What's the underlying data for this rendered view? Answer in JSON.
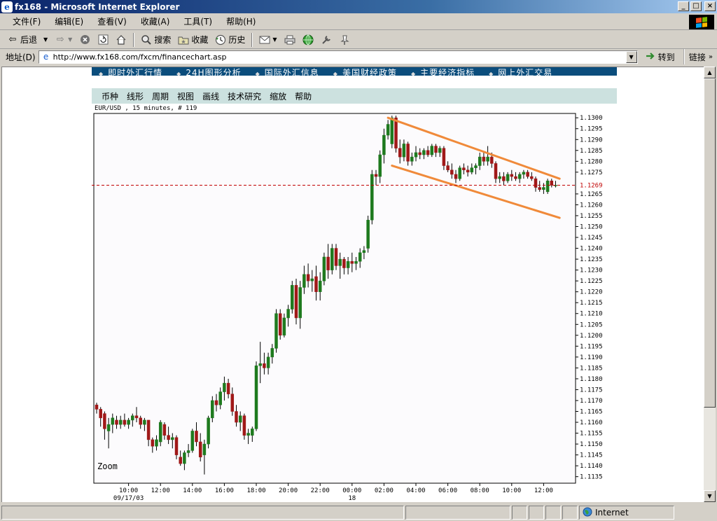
{
  "window": {
    "title": "fx168 - Microsoft Internet Explorer",
    "buttons": [
      "_",
      "□",
      "×"
    ]
  },
  "menubar": {
    "items": [
      "文件(F)",
      "编辑(E)",
      "查看(V)",
      "收藏(A)",
      "工具(T)",
      "帮助(H)"
    ]
  },
  "toolbar": {
    "back_label": "后退",
    "search_label": "搜索",
    "favorites_label": "收藏",
    "history_label": "历史"
  },
  "address": {
    "label": "地址(D)",
    "url": "http://www.fx168.com/fxcm/financechart.asp",
    "go_label": "转到",
    "links_label": "链接"
  },
  "status": {
    "zone": "Internet"
  },
  "site_nav": [
    "即时外汇行情",
    "24H图形分析",
    "国际外汇信息",
    "美国财经政策",
    "主要经济指标",
    "网上外汇交易"
  ],
  "chart_menu": [
    "币种",
    "线形",
    "周期",
    "视图",
    "画线",
    "技术研究",
    "缩放",
    "帮助"
  ],
  "chart_header": "EUR/USD , 15 minutes, # 119",
  "zoom_label": "Zoom",
  "colors": {
    "up": "#1e7a1e",
    "down": "#a01818",
    "channel": "#f08a3a",
    "price_line": "#c00000",
    "chart_bg": "#fcfbfd",
    "menu_bg": "#cce1df",
    "site_nav_bg": "#0b4d7c"
  },
  "chart_data": {
    "type": "candlestick",
    "symbol": "EUR/USD",
    "timeframe": "15 minutes",
    "ylim": [
      1.1132,
      1.1302
    ],
    "ytick_values": [
      1.1135,
      1.114,
      1.1145,
      1.115,
      1.1155,
      1.116,
      1.1165,
      1.117,
      1.1175,
      1.118,
      1.1185,
      1.119,
      1.1195,
      1.12,
      1.1205,
      1.121,
      1.1215,
      1.122,
      1.1225,
      1.123,
      1.1235,
      1.124,
      1.1245,
      1.125,
      1.1255,
      1.126,
      1.1265,
      1.127,
      1.1275,
      1.128,
      1.1285,
      1.129,
      1.1295,
      1.13
    ],
    "ytick_labels": [
      "1.1135",
      "1.1140",
      "1.1145",
      "1.1150",
      "1.1155",
      "1.1160",
      "1.1165",
      "1.1170",
      "1.1175",
      "1.1180",
      "1.1185",
      "1.1190",
      "1.1195",
      "1.1200",
      "1.1205",
      "1.1210",
      "1.1215",
      "1.1220",
      "1.1225",
      "1.1230",
      "1.1235",
      "1.1240",
      "1.1245",
      "1.1250",
      "1.1255",
      "1.1260",
      "1.1265",
      "1.1270",
      "1.1275",
      "1.1280",
      "1.1285",
      "1.1290",
      "1.1295",
      "1.1300"
    ],
    "xticks": [
      {
        "label": "10:00",
        "sub": "09/17/03",
        "t": "2003-09-17 10:00"
      },
      {
        "label": "12:00",
        "sub": "",
        "t": "2003-09-17 12:00"
      },
      {
        "label": "14:00",
        "sub": "",
        "t": "2003-09-17 14:00"
      },
      {
        "label": "16:00",
        "sub": "",
        "t": "2003-09-17 16:00"
      },
      {
        "label": "18:00",
        "sub": "",
        "t": "2003-09-17 18:00"
      },
      {
        "label": "20:00",
        "sub": "",
        "t": "2003-09-17 20:00"
      },
      {
        "label": "22:00",
        "sub": "",
        "t": "2003-09-17 22:00"
      },
      {
        "label": "00:00",
        "sub": "18",
        "t": "2003-09-18 00:00"
      },
      {
        "label": "02:00",
        "sub": "",
        "t": "2003-09-18 02:00"
      },
      {
        "label": "04:00",
        "sub": "",
        "t": "2003-09-18 04:00"
      },
      {
        "label": "06:00",
        "sub": "",
        "t": "2003-09-18 06:00"
      },
      {
        "label": "08:00",
        "sub": "",
        "t": "2003-09-18 08:00"
      },
      {
        "label": "10:00",
        "sub": "",
        "t": "2003-09-18 10:00"
      },
      {
        "label": "12:00",
        "sub": "",
        "t": "2003-09-18 12:00"
      }
    ],
    "current_price": 1.1269,
    "current_price_label": "1.1269",
    "channel_lines": [
      {
        "from": {
          "t": "2003-09-18 02:15",
          "y": 1.13
        },
        "to": {
          "t": "2003-09-18 13:00",
          "y": 1.1272
        }
      },
      {
        "from": {
          "t": "2003-09-18 02:30",
          "y": 1.1278
        },
        "to": {
          "t": "2003-09-18 13:00",
          "y": 1.1254
        }
      }
    ],
    "candles": [
      {
        "t": "2003-09-17 08:00",
        "o": 1.1168,
        "h": 1.1169,
        "l": 1.1164,
        "c": 1.1166
      },
      {
        "t": "2003-09-17 08:15",
        "o": 1.1166,
        "h": 1.1167,
        "l": 1.1158,
        "c": 1.1162
      },
      {
        "t": "2003-09-17 08:30",
        "o": 1.1164,
        "h": 1.1165,
        "l": 1.1152,
        "c": 1.1157
      },
      {
        "t": "2003-09-17 08:45",
        "o": 1.1156,
        "h": 1.1162,
        "l": 1.1148,
        "c": 1.1159
      },
      {
        "t": "2003-09-17 09:00",
        "o": 1.1159,
        "h": 1.1164,
        "l": 1.1155,
        "c": 1.1162
      },
      {
        "t": "2003-09-17 09:15",
        "o": 1.1161,
        "h": 1.1163,
        "l": 1.1157,
        "c": 1.1159
      },
      {
        "t": "2003-09-17 09:30",
        "o": 1.1159,
        "h": 1.1163,
        "l": 1.1157,
        "c": 1.1161
      },
      {
        "t": "2003-09-17 09:45",
        "o": 1.1161,
        "h": 1.1164,
        "l": 1.1158,
        "c": 1.1159
      },
      {
        "t": "2003-09-17 10:00",
        "o": 1.1159,
        "h": 1.1162,
        "l": 1.1157,
        "c": 1.1161
      },
      {
        "t": "2003-09-17 10:15",
        "o": 1.1161,
        "h": 1.1164,
        "l": 1.1158,
        "c": 1.1163
      },
      {
        "t": "2003-09-17 10:30",
        "o": 1.1163,
        "h": 1.1167,
        "l": 1.116,
        "c": 1.1162
      },
      {
        "t": "2003-09-17 10:45",
        "o": 1.1162,
        "h": 1.1163,
        "l": 1.1157,
        "c": 1.1159
      },
      {
        "t": "2003-09-17 11:00",
        "o": 1.1159,
        "h": 1.1162,
        "l": 1.1156,
        "c": 1.1161
      },
      {
        "t": "2003-09-17 11:15",
        "o": 1.1161,
        "h": 1.1161,
        "l": 1.1149,
        "c": 1.1152
      },
      {
        "t": "2003-09-17 11:30",
        "o": 1.1152,
        "h": 1.1153,
        "l": 1.1146,
        "c": 1.1149
      },
      {
        "t": "2003-09-17 11:45",
        "o": 1.1149,
        "h": 1.1154,
        "l": 1.1147,
        "c": 1.1152
      },
      {
        "t": "2003-09-17 12:00",
        "o": 1.1151,
        "h": 1.1161,
        "l": 1.1149,
        "c": 1.116
      },
      {
        "t": "2003-09-17 12:15",
        "o": 1.1159,
        "h": 1.116,
        "l": 1.1152,
        "c": 1.1154
      },
      {
        "t": "2003-09-17 12:30",
        "o": 1.1154,
        "h": 1.1158,
        "l": 1.115,
        "c": 1.1152
      },
      {
        "t": "2003-09-17 12:45",
        "o": 1.1152,
        "h": 1.1155,
        "l": 1.1148,
        "c": 1.1153
      },
      {
        "t": "2003-09-17 13:00",
        "o": 1.1153,
        "h": 1.1154,
        "l": 1.1143,
        "c": 1.1145
      },
      {
        "t": "2003-09-17 13:15",
        "o": 1.1144,
        "h": 1.1147,
        "l": 1.114,
        "c": 1.1141
      },
      {
        "t": "2003-09-17 13:30",
        "o": 1.1141,
        "h": 1.1147,
        "l": 1.1138,
        "c": 1.1146
      },
      {
        "t": "2003-09-17 13:45",
        "o": 1.1146,
        "h": 1.115,
        "l": 1.1144,
        "c": 1.1147
      },
      {
        "t": "2003-09-17 14:00",
        "o": 1.1147,
        "h": 1.1157,
        "l": 1.1146,
        "c": 1.1156
      },
      {
        "t": "2003-09-17 14:15",
        "o": 1.1156,
        "h": 1.116,
        "l": 1.1149,
        "c": 1.1151
      },
      {
        "t": "2003-09-17 14:30",
        "o": 1.1151,
        "h": 1.1155,
        "l": 1.1142,
        "c": 1.1144
      },
      {
        "t": "2003-09-17 14:45",
        "o": 1.1145,
        "h": 1.1152,
        "l": 1.1136,
        "c": 1.115
      },
      {
        "t": "2003-09-17 15:00",
        "o": 1.115,
        "h": 1.1163,
        "l": 1.1148,
        "c": 1.1162
      },
      {
        "t": "2003-09-17 15:15",
        "o": 1.1162,
        "h": 1.1172,
        "l": 1.116,
        "c": 1.117
      },
      {
        "t": "2003-09-17 15:30",
        "o": 1.117,
        "h": 1.1173,
        "l": 1.1165,
        "c": 1.1168
      },
      {
        "t": "2003-09-17 15:45",
        "o": 1.1168,
        "h": 1.1176,
        "l": 1.1166,
        "c": 1.1174
      },
      {
        "t": "2003-09-17 16:00",
        "o": 1.1174,
        "h": 1.1181,
        "l": 1.117,
        "c": 1.1178
      },
      {
        "t": "2003-09-17 16:15",
        "o": 1.1178,
        "h": 1.118,
        "l": 1.1171,
        "c": 1.1173
      },
      {
        "t": "2003-09-17 16:30",
        "o": 1.1173,
        "h": 1.1176,
        "l": 1.1163,
        "c": 1.1165
      },
      {
        "t": "2003-09-17 16:45",
        "o": 1.1165,
        "h": 1.1168,
        "l": 1.1158,
        "c": 1.116
      },
      {
        "t": "2003-09-17 17:00",
        "o": 1.116,
        "h": 1.1165,
        "l": 1.1156,
        "c": 1.1163
      },
      {
        "t": "2003-09-17 17:15",
        "o": 1.1163,
        "h": 1.1164,
        "l": 1.1152,
        "c": 1.1154
      },
      {
        "t": "2003-09-17 17:30",
        "o": 1.1154,
        "h": 1.1157,
        "l": 1.115,
        "c": 1.1155
      },
      {
        "t": "2003-09-17 17:45",
        "o": 1.1154,
        "h": 1.1158,
        "l": 1.1151,
        "c": 1.1157
      },
      {
        "t": "2003-09-17 18:00",
        "o": 1.1157,
        "h": 1.1188,
        "l": 1.1156,
        "c": 1.1186
      },
      {
        "t": "2003-09-17 18:15",
        "o": 1.1186,
        "h": 1.1197,
        "l": 1.1178,
        "c": 1.1187
      },
      {
        "t": "2003-09-17 18:30",
        "o": 1.1187,
        "h": 1.1192,
        "l": 1.1182,
        "c": 1.1185
      },
      {
        "t": "2003-09-17 18:45",
        "o": 1.1185,
        "h": 1.1192,
        "l": 1.1182,
        "c": 1.119
      },
      {
        "t": "2003-09-17 19:00",
        "o": 1.119,
        "h": 1.1196,
        "l": 1.1187,
        "c": 1.1194
      },
      {
        "t": "2003-09-17 19:15",
        "o": 1.1194,
        "h": 1.1212,
        "l": 1.1192,
        "c": 1.121
      },
      {
        "t": "2003-09-17 19:30",
        "o": 1.121,
        "h": 1.1212,
        "l": 1.1198,
        "c": 1.12
      },
      {
        "t": "2003-09-17 19:45",
        "o": 1.12,
        "h": 1.121,
        "l": 1.1199,
        "c": 1.1208
      },
      {
        "t": "2003-09-17 20:00",
        "o": 1.1208,
        "h": 1.1214,
        "l": 1.1204,
        "c": 1.1212
      },
      {
        "t": "2003-09-17 20:15",
        "o": 1.1212,
        "h": 1.1225,
        "l": 1.121,
        "c": 1.1223
      },
      {
        "t": "2003-09-17 20:30",
        "o": 1.1223,
        "h": 1.1226,
        "l": 1.1205,
        "c": 1.1208
      },
      {
        "t": "2003-09-17 20:45",
        "o": 1.1208,
        "h": 1.1225,
        "l": 1.1203,
        "c": 1.1222
      },
      {
        "t": "2003-09-17 21:00",
        "o": 1.1222,
        "h": 1.1232,
        "l": 1.1219,
        "c": 1.1228
      },
      {
        "t": "2003-09-17 21:15",
        "o": 1.1228,
        "h": 1.1233,
        "l": 1.1222,
        "c": 1.1225
      },
      {
        "t": "2003-09-17 21:30",
        "o": 1.1225,
        "h": 1.123,
        "l": 1.122,
        "c": 1.1226
      },
      {
        "t": "2003-09-17 21:45",
        "o": 1.1227,
        "h": 1.1232,
        "l": 1.1216,
        "c": 1.122
      },
      {
        "t": "2003-09-17 22:00",
        "o": 1.122,
        "h": 1.1229,
        "l": 1.1216,
        "c": 1.1225
      },
      {
        "t": "2003-09-17 22:15",
        "o": 1.1225,
        "h": 1.1238,
        "l": 1.1223,
        "c": 1.1236
      },
      {
        "t": "2003-09-17 22:30",
        "o": 1.1236,
        "h": 1.1242,
        "l": 1.1226,
        "c": 1.123
      },
      {
        "t": "2003-09-17 22:45",
        "o": 1.123,
        "h": 1.1242,
        "l": 1.1228,
        "c": 1.124
      },
      {
        "t": "2003-09-17 23:00",
        "o": 1.124,
        "h": 1.1242,
        "l": 1.123,
        "c": 1.1232
      },
      {
        "t": "2003-09-17 23:15",
        "o": 1.1232,
        "h": 1.1238,
        "l": 1.1226,
        "c": 1.1235
      },
      {
        "t": "2003-09-17 23:30",
        "o": 1.1235,
        "h": 1.1236,
        "l": 1.1228,
        "c": 1.1231
      },
      {
        "t": "2003-09-17 23:45",
        "o": 1.1231,
        "h": 1.1236,
        "l": 1.1228,
        "c": 1.1234
      },
      {
        "t": "2003-09-18 00:00",
        "o": 1.1234,
        "h": 1.1238,
        "l": 1.1229,
        "c": 1.1233
      },
      {
        "t": "2003-09-18 00:15",
        "o": 1.1233,
        "h": 1.1236,
        "l": 1.123,
        "c": 1.1234
      },
      {
        "t": "2003-09-18 00:30",
        "o": 1.1234,
        "h": 1.124,
        "l": 1.1231,
        "c": 1.1238
      },
      {
        "t": "2003-09-18 00:45",
        "o": 1.1238,
        "h": 1.1241,
        "l": 1.1235,
        "c": 1.1239
      },
      {
        "t": "2003-09-18 01:00",
        "o": 1.124,
        "h": 1.1255,
        "l": 1.1238,
        "c": 1.1253
      },
      {
        "t": "2003-09-18 01:15",
        "o": 1.1253,
        "h": 1.1276,
        "l": 1.1251,
        "c": 1.1274
      },
      {
        "t": "2003-09-18 01:30",
        "o": 1.1274,
        "h": 1.1276,
        "l": 1.1269,
        "c": 1.1273
      },
      {
        "t": "2003-09-18 01:45",
        "o": 1.1273,
        "h": 1.1285,
        "l": 1.127,
        "c": 1.1283
      },
      {
        "t": "2003-09-18 02:00",
        "o": 1.1283,
        "h": 1.1295,
        "l": 1.1279,
        "c": 1.1292
      },
      {
        "t": "2003-09-18 02:15",
        "o": 1.1292,
        "h": 1.1299,
        "l": 1.129,
        "c": 1.1297
      },
      {
        "t": "2003-09-18 02:30",
        "o": 1.1288,
        "h": 1.1301,
        "l": 1.1286,
        "c": 1.13
      },
      {
        "t": "2003-09-18 02:45",
        "o": 1.13,
        "h": 1.1301,
        "l": 1.1284,
        "c": 1.1286
      },
      {
        "t": "2003-09-18 03:00",
        "o": 1.1286,
        "h": 1.129,
        "l": 1.1279,
        "c": 1.1282
      },
      {
        "t": "2003-09-18 03:15",
        "o": 1.1282,
        "h": 1.129,
        "l": 1.128,
        "c": 1.1288
      },
      {
        "t": "2003-09-18 03:30",
        "o": 1.1288,
        "h": 1.1289,
        "l": 1.1278,
        "c": 1.128
      },
      {
        "t": "2003-09-18 03:45",
        "o": 1.128,
        "h": 1.1284,
        "l": 1.1278,
        "c": 1.1282
      },
      {
        "t": "2003-09-18 04:00",
        "o": 1.1282,
        "h": 1.1287,
        "l": 1.128,
        "c": 1.1284
      },
      {
        "t": "2003-09-18 04:15",
        "o": 1.1284,
        "h": 1.1286,
        "l": 1.1281,
        "c": 1.1283
      },
      {
        "t": "2003-09-18 04:30",
        "o": 1.1283,
        "h": 1.1286,
        "l": 1.1281,
        "c": 1.1285
      },
      {
        "t": "2003-09-18 04:45",
        "o": 1.1285,
        "h": 1.1287,
        "l": 1.1282,
        "c": 1.1283
      },
      {
        "t": "2003-09-18 05:00",
        "o": 1.1283,
        "h": 1.1288,
        "l": 1.1282,
        "c": 1.1287
      },
      {
        "t": "2003-09-18 05:15",
        "o": 1.1287,
        "h": 1.1288,
        "l": 1.1282,
        "c": 1.1284
      },
      {
        "t": "2003-09-18 05:30",
        "o": 1.1284,
        "h": 1.1287,
        "l": 1.1282,
        "c": 1.1286
      },
      {
        "t": "2003-09-18 05:45",
        "o": 1.1286,
        "h": 1.1287,
        "l": 1.1276,
        "c": 1.1278
      },
      {
        "t": "2003-09-18 06:00",
        "o": 1.1278,
        "h": 1.128,
        "l": 1.1275,
        "c": 1.1276
      },
      {
        "t": "2003-09-18 06:15",
        "o": 1.1276,
        "h": 1.1279,
        "l": 1.1272,
        "c": 1.1274
      },
      {
        "t": "2003-09-18 06:30",
        "o": 1.1274,
        "h": 1.1276,
        "l": 1.127,
        "c": 1.1272
      },
      {
        "t": "2003-09-18 06:45",
        "o": 1.1272,
        "h": 1.1278,
        "l": 1.1271,
        "c": 1.1277
      },
      {
        "t": "2003-09-18 07:00",
        "o": 1.1277,
        "h": 1.1279,
        "l": 1.1274,
        "c": 1.1276
      },
      {
        "t": "2003-09-18 07:15",
        "o": 1.1276,
        "h": 1.1278,
        "l": 1.1273,
        "c": 1.1275
      },
      {
        "t": "2003-09-18 07:30",
        "o": 1.1275,
        "h": 1.1279,
        "l": 1.1274,
        "c": 1.1277
      },
      {
        "t": "2003-09-18 07:45",
        "o": 1.1277,
        "h": 1.1279,
        "l": 1.1274,
        "c": 1.1278
      },
      {
        "t": "2003-09-18 08:00",
        "o": 1.1278,
        "h": 1.1284,
        "l": 1.1276,
        "c": 1.1282
      },
      {
        "t": "2003-09-18 08:15",
        "o": 1.1282,
        "h": 1.1284,
        "l": 1.1278,
        "c": 1.128
      },
      {
        "t": "2003-09-18 08:30",
        "o": 1.128,
        "h": 1.1287,
        "l": 1.1278,
        "c": 1.1282
      },
      {
        "t": "2003-09-18 08:45",
        "o": 1.1282,
        "h": 1.1284,
        "l": 1.1277,
        "c": 1.1279
      },
      {
        "t": "2003-09-18 09:00",
        "o": 1.1279,
        "h": 1.128,
        "l": 1.127,
        "c": 1.1272
      },
      {
        "t": "2003-09-18 09:15",
        "o": 1.1272,
        "h": 1.1275,
        "l": 1.127,
        "c": 1.1273
      },
      {
        "t": "2003-09-18 09:30",
        "o": 1.1273,
        "h": 1.1275,
        "l": 1.1269,
        "c": 1.1271
      },
      {
        "t": "2003-09-18 09:45",
        "o": 1.1271,
        "h": 1.1275,
        "l": 1.127,
        "c": 1.1274
      },
      {
        "t": "2003-09-18 10:00",
        "o": 1.1274,
        "h": 1.1276,
        "l": 1.1271,
        "c": 1.1273
      },
      {
        "t": "2003-09-18 10:15",
        "o": 1.1273,
        "h": 1.1275,
        "l": 1.1271,
        "c": 1.1272
      },
      {
        "t": "2003-09-18 10:30",
        "o": 1.1272,
        "h": 1.1275,
        "l": 1.127,
        "c": 1.1274
      },
      {
        "t": "2003-09-18 10:45",
        "o": 1.1274,
        "h": 1.1276,
        "l": 1.1272,
        "c": 1.1275
      },
      {
        "t": "2003-09-18 11:00",
        "o": 1.1275,
        "h": 1.1276,
        "l": 1.1272,
        "c": 1.1273
      },
      {
        "t": "2003-09-18 11:15",
        "o": 1.1273,
        "h": 1.1275,
        "l": 1.1271,
        "c": 1.1272
      },
      {
        "t": "2003-09-18 11:30",
        "o": 1.1272,
        "h": 1.1273,
        "l": 1.1266,
        "c": 1.1268
      },
      {
        "t": "2003-09-18 11:45",
        "o": 1.1268,
        "h": 1.1271,
        "l": 1.1266,
        "c": 1.1267
      },
      {
        "t": "2003-09-18 12:00",
        "o": 1.1267,
        "h": 1.127,
        "l": 1.1265,
        "c": 1.1268
      },
      {
        "t": "2003-09-18 12:15",
        "o": 1.1266,
        "h": 1.1272,
        "l": 1.1265,
        "c": 1.1271
      },
      {
        "t": "2003-09-18 12:30",
        "o": 1.1271,
        "h": 1.1272,
        "l": 1.1268,
        "c": 1.1269
      },
      {
        "t": "2003-09-18 12:45",
        "o": 1.1269,
        "h": 1.1271,
        "l": 1.1268,
        "c": 1.1269
      }
    ]
  }
}
